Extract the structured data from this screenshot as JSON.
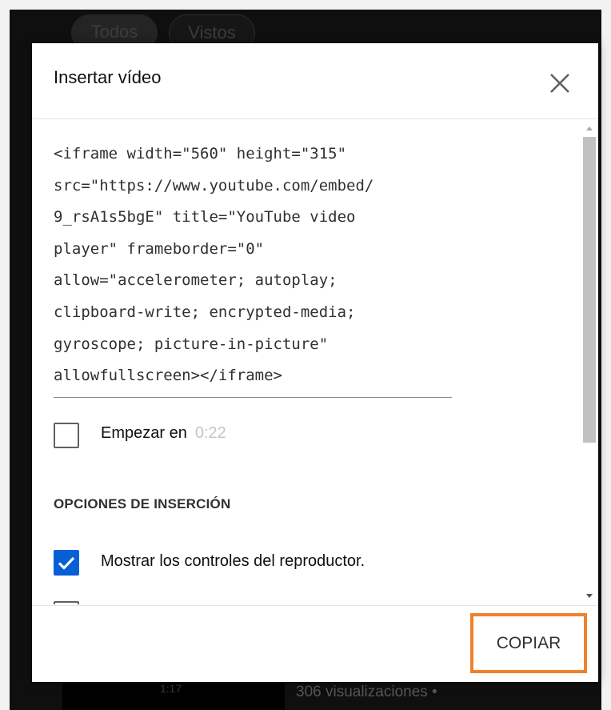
{
  "background": {
    "chips": [
      "Todos",
      "Vistos"
    ],
    "thumbnail_text": "1:17",
    "views_text": "306 visualizaciones •"
  },
  "dialog": {
    "title": "Insertar vídeo",
    "close_icon": "close-icon",
    "embed_code_lines": [
      "<iframe width=\"560\" height=\"315\"",
      "src=\"https://www.youtube.com/embed/",
      "9_rsA1s5bgE\" title=\"YouTube video",
      "player\" frameborder=\"0\"",
      "allow=\"accelerometer; autoplay;",
      "clipboard-write; encrypted-media;",
      "gyroscope; picture-in-picture\"",
      "allowfullscreen></iframe>"
    ],
    "start_at": {
      "label": "Empezar en",
      "time": "0:22",
      "checked": false
    },
    "embed_options": {
      "heading": "OPCIONES DE INSERCIÓN",
      "items": [
        {
          "label": "Mostrar los controles del reproductor.",
          "checked": true
        },
        {
          "label": "",
          "checked": false
        }
      ]
    },
    "copy_button": "COPIAR"
  },
  "colors": {
    "checkbox_checked": "#065fd4",
    "highlight_border": "#f0812c"
  }
}
